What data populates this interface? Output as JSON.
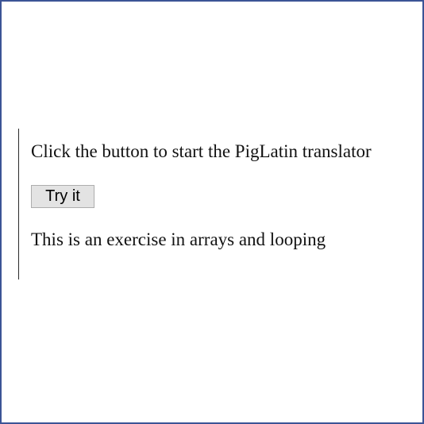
{
  "page": {
    "instruction": "Click the button to start the PigLatin translator",
    "button_label": "Try it",
    "note": "This is an exercise in arrays and looping"
  },
  "colors": {
    "frame_border": "#3b5496",
    "button_background": "#e3e3e3",
    "button_border": "#adadad",
    "text": "#111111"
  }
}
